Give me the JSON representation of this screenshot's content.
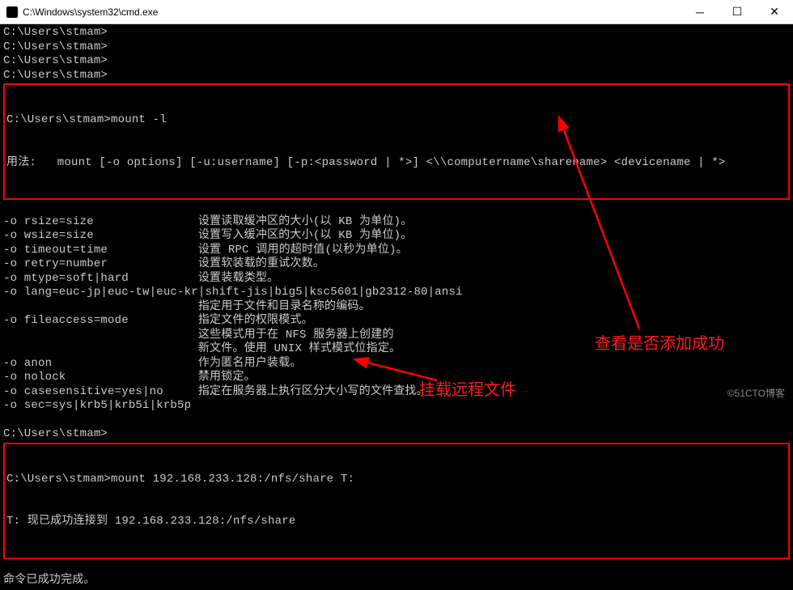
{
  "window": {
    "title": "C:\\Windows\\system32\\cmd.exe"
  },
  "prompts": {
    "p1": "C:\\Users\\stmam>",
    "p2": "C:\\Users\\stmam>",
    "p3": "C:\\Users\\stmam>",
    "p4": "C:\\Users\\stmam>",
    "p5": "C:\\Users\\stmam>",
    "p6": "C:\\Users\\stmam>"
  },
  "cmds": {
    "mount_l": "mount -l",
    "usage": "用法:   mount [-o options] [-u:username] [-p:<password | *>] <\\\\computername\\sharename> <devicename | *>",
    "opts": {
      "rsize": "-o rsize=size               设置读取缓冲区的大小(以 KB 为单位)。",
      "wsize": "-o wsize=size               设置写入缓冲区的大小(以 KB 为单位)。",
      "timeout": "-o timeout=time             设置 RPC 调用的超时值(以秒为单位)。",
      "retry": "-o retry=number             设置软装载的重试次数。",
      "mtype": "-o mtype=soft|hard          设置装载类型。",
      "lang": "-o lang=euc-jp|euc-tw|euc-kr|shift-jis|big5|ksc5601|gb2312-80|ansi",
      "lang2": "                            指定用于文件和目录名称的编码。",
      "fileaccess": "-o fileaccess=mode          指定文件的权限模式。",
      "fa2": "                            这些模式用于在 NFS 服务器上创建的",
      "fa3": "                            新文件。使用 UNIX 样式模式位指定。",
      "anon": "-o anon                     作为匿名用户装载。",
      "nolock": "-o nolock                   禁用锁定。",
      "cases": "-o casesensitive=yes|no     指定在服务器上执行区分大小写的文件查找。",
      "sec": "-o sec=sys|krb5|krb5i|krb5p"
    },
    "mount_cmd": "mount 192.168.233.128:/nfs/share T:",
    "mount_result": "T: 现已成功连接到 192.168.233.128:/nfs/share",
    "success": "命令已成功完成。"
  },
  "annotations": {
    "a1": "查看是否添加成功",
    "a2": "挂载远程文件"
  },
  "watermark": "©51CTO博客"
}
